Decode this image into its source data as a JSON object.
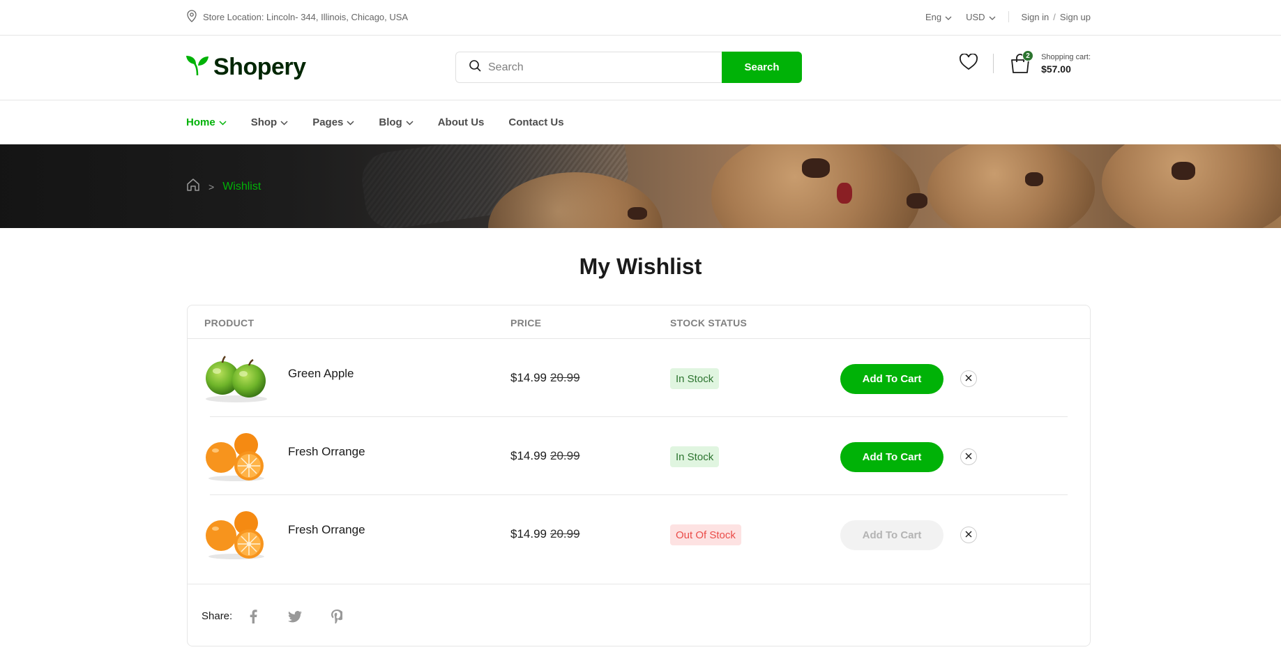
{
  "topbar": {
    "location": "Store Location: Lincoln- 344, Illinois, Chicago, USA",
    "language": "Eng",
    "currency": "USD",
    "sign_in": "Sign in",
    "separator": "/",
    "sign_up": "Sign up"
  },
  "header": {
    "logo": "Shopery",
    "search_placeholder": "Search",
    "search_button": "Search",
    "cart_count": "2",
    "cart_label": "Shopping cart:",
    "cart_total": "$57.00"
  },
  "nav": {
    "items": [
      {
        "label": "Home",
        "dropdown": true,
        "active": true
      },
      {
        "label": "Shop",
        "dropdown": true
      },
      {
        "label": "Pages",
        "dropdown": true
      },
      {
        "label": "Blog",
        "dropdown": true
      },
      {
        "label": "About Us"
      },
      {
        "label": "Contact Us"
      }
    ]
  },
  "breadcrumb": {
    "sep": ">",
    "current": "Wishlist"
  },
  "title": "My Wishlist",
  "table": {
    "headers": {
      "product": "PRODUCT",
      "price": "PRICE",
      "stock": "STOCK STATUS"
    },
    "rows": [
      {
        "name": "Green Apple",
        "price": "$14.99",
        "old_price": "20.99",
        "status": "In Stock",
        "button": "Add To Cart",
        "image": "green-apple"
      },
      {
        "name": "Fresh Orrange",
        "price": "$14.99",
        "old_price": "20.99",
        "status": "In Stock",
        "button": "Add To Cart",
        "image": "orange"
      },
      {
        "name": "Fresh Orrange",
        "price": "$14.99",
        "old_price": "20.99",
        "status": "Out Of Stock",
        "button": "Add To Cart",
        "image": "orange"
      }
    ]
  },
  "share": {
    "label": "Share:",
    "icons": [
      "facebook-icon",
      "twitter-icon",
      "pinterest-icon",
      "instagram-icon"
    ]
  },
  "colors": {
    "primary": "#00b207",
    "dark": "#002603",
    "badge_in_bg": "#e0f5e0",
    "badge_out_bg": "#fde2e2",
    "badge_out_text": "#ea4b48"
  }
}
